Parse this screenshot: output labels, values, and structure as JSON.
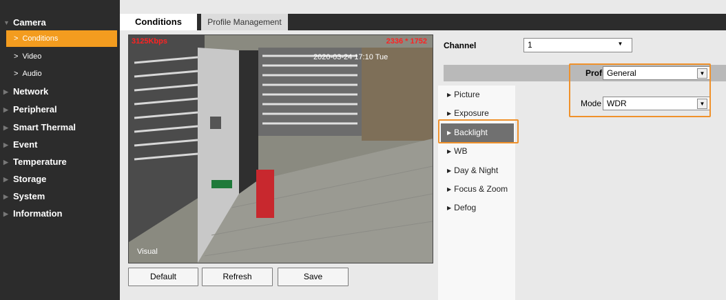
{
  "sidebar": {
    "items": [
      {
        "label": "Camera"
      },
      {
        "label": "Conditions"
      },
      {
        "label": "Video"
      },
      {
        "label": "Audio"
      },
      {
        "label": "Network"
      },
      {
        "label": "Peripheral"
      },
      {
        "label": "Smart Thermal"
      },
      {
        "label": "Event"
      },
      {
        "label": "Temperature"
      },
      {
        "label": "Storage"
      },
      {
        "label": "System"
      },
      {
        "label": "Information"
      }
    ]
  },
  "tabs": [
    "Conditions",
    "Profile Management"
  ],
  "video": {
    "bitrate": "3125Kbps",
    "resolution": "2336 * 1752",
    "timestamp": "2020-03-24 17:10 Tue",
    "label": "Visual"
  },
  "buttons": {
    "default": "Default",
    "refresh": "Refresh",
    "save": "Save"
  },
  "channel": {
    "label": "Channel",
    "value": "1"
  },
  "subnav": [
    "Picture",
    "Exposure",
    "Backlight",
    "WB",
    "Day & Night",
    "Focus & Zoom",
    "Defog"
  ],
  "profile": {
    "label": "Profile",
    "value": "General"
  },
  "mode": {
    "label": "Mode",
    "value": "WDR"
  },
  "colors": {
    "accent": "#f39c1f",
    "highlight": "#f0912a",
    "dark_bg": "#2c2c2c"
  }
}
